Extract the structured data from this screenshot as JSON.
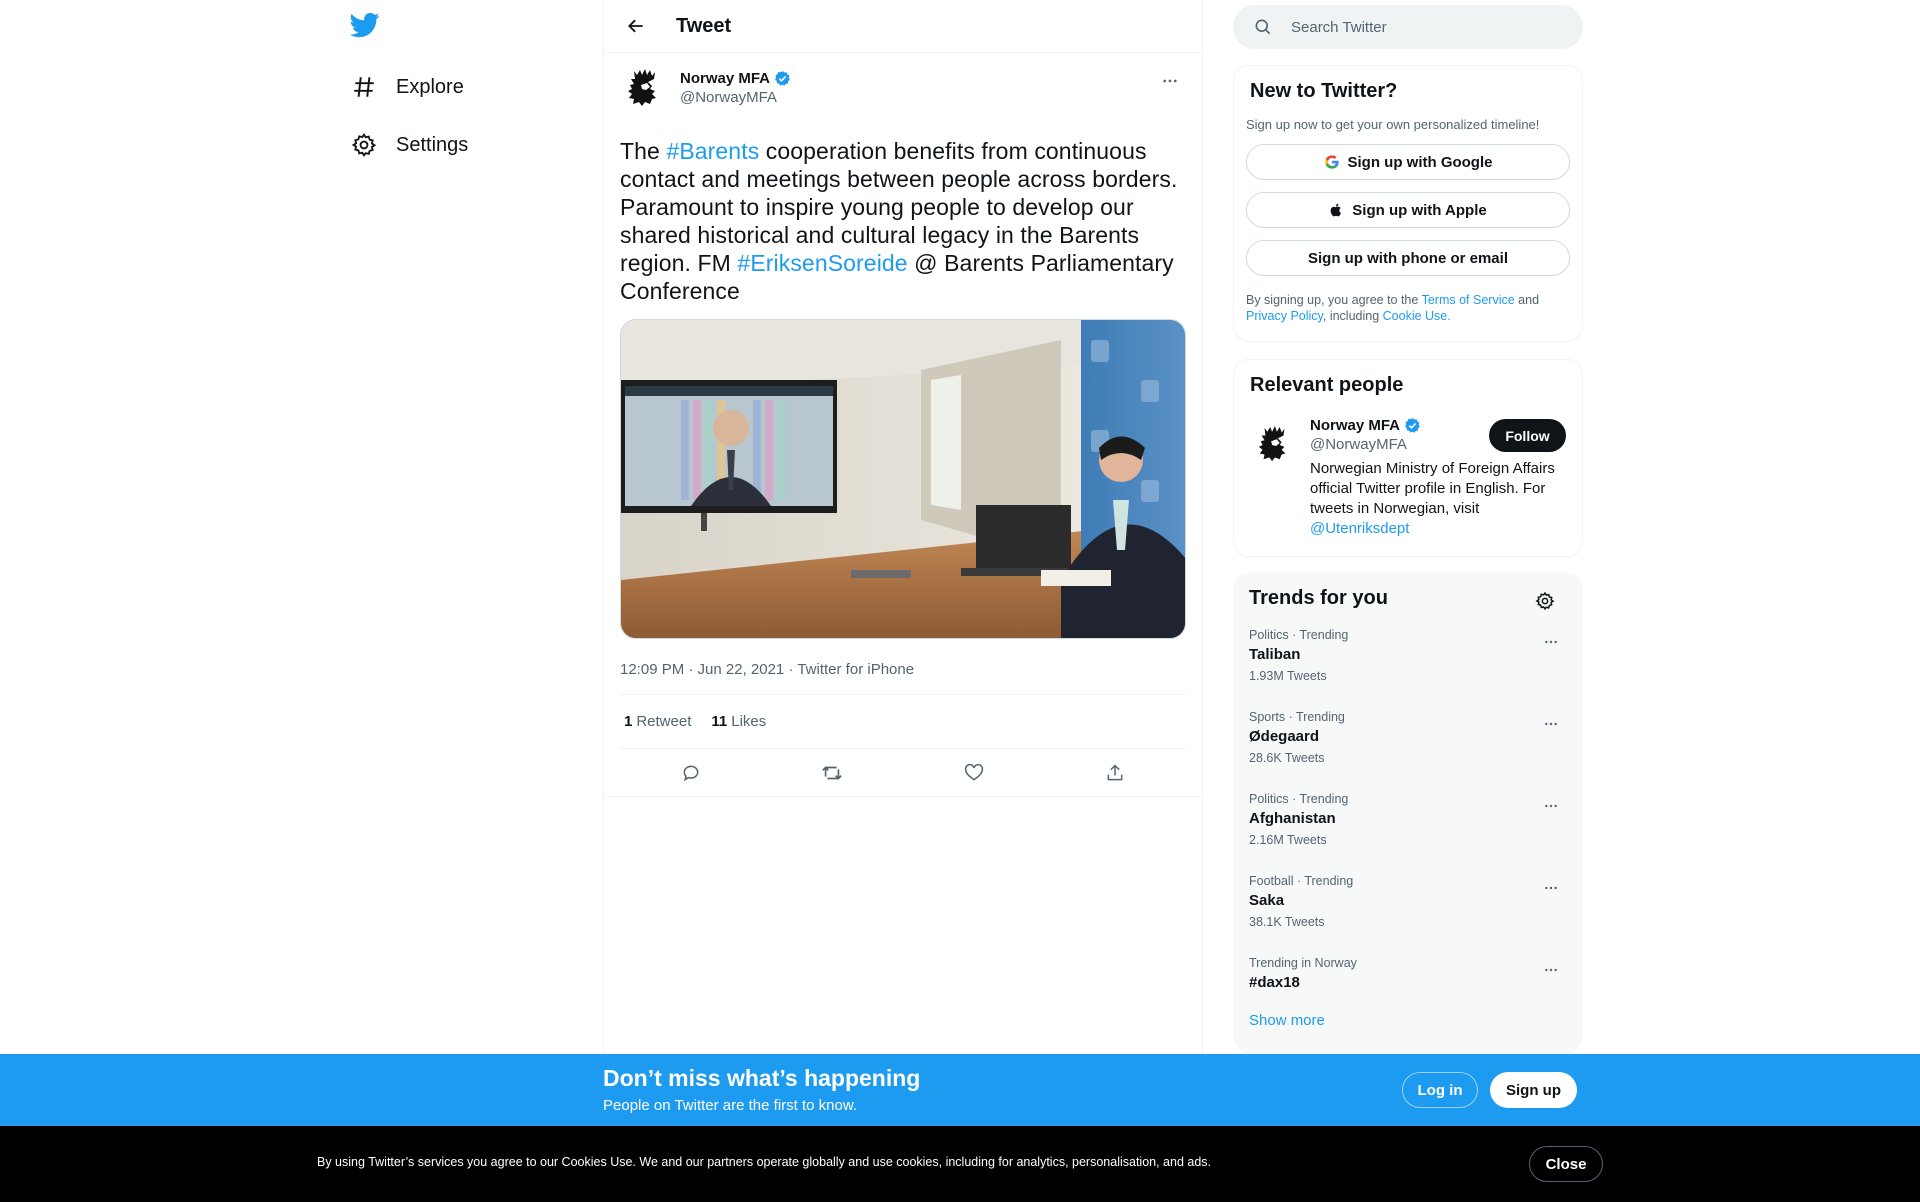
{
  "colors": {
    "accent": "#1d9bf0",
    "text": "#0f1419",
    "muted": "#536471",
    "cookie_bg": "#000000"
  },
  "nav": {
    "logo_icon": "twitter-bird-icon",
    "items": [
      {
        "label": "Explore",
        "icon": "hashtag-icon"
      },
      {
        "label": "Settings",
        "icon": "gear-icon"
      }
    ]
  },
  "header": {
    "title": "Tweet",
    "back_icon": "arrow-left-icon"
  },
  "tweet": {
    "author_name": "Norway MFA",
    "author_handle": "@NorwayMFA",
    "verified": true,
    "text_parts": {
      "p1": "The ",
      "h1": "#Barents",
      "p2": " cooperation benefits from continuous contact and meetings between people across borders. Paramount to inspire young people to develop our shared historical and cultural legacy in the Barents region. FM ",
      "h2": "#EriksenSoreide",
      "p3": " @ Barents Parliamentary Conference"
    },
    "timestamp": "12:09 PM · Jun 22, 2021",
    "separator": " · ",
    "source": "Twitter for iPhone",
    "retweets_count": "1",
    "retweets_label": "Retweet",
    "likes_count": "11",
    "likes_label": "Likes"
  },
  "search": {
    "placeholder": "Search Twitter"
  },
  "new_to_twitter": {
    "title": "New to Twitter?",
    "subtitle": "Sign up now to get your own personalized timeline!",
    "google": "Sign up with Google",
    "apple": "Sign up with Apple",
    "phone": "Sign up with phone or email",
    "legal_1": "By signing up, you agree to the ",
    "tos": "Terms of Service",
    "legal_2": " and ",
    "privacy": "Privacy Policy",
    "legal_3": ", including ",
    "cookie": "Cookie Use."
  },
  "relevant": {
    "title": "Relevant people",
    "name": "Norway MFA",
    "handle": "@NorwayMFA",
    "bio": "Norwegian Ministry of Foreign Affairs official Twitter profile in English. For tweets in Norwegian, visit ",
    "bio_link": "@Utenriksdept",
    "follow": "Follow"
  },
  "trends": {
    "title": "Trends for you",
    "items": [
      {
        "context": "Politics · Trending",
        "name": "Taliban",
        "count": "1.93M Tweets"
      },
      {
        "context": "Sports · Trending",
        "name": "Ødegaard",
        "count": "28.6K Tweets"
      },
      {
        "context": "Politics · Trending",
        "name": "Afghanistan",
        "count": "2.16M Tweets"
      },
      {
        "context": "Football · Trending",
        "name": "Saka",
        "count": "38.1K Tweets"
      },
      {
        "context": "Trending in Norway",
        "name": "#dax18",
        "count": ""
      }
    ],
    "show_more": "Show more"
  },
  "signup_bar": {
    "title": "Don’t miss what’s happening",
    "subtitle": "People on Twitter are the first to know.",
    "login": "Log in",
    "signup": "Sign up"
  },
  "cookie_bar": {
    "text": "By using Twitter’s services you agree to our Cookies Use. We and our partners operate globally and use cookies, including for analytics, personalisation, and ads.",
    "close": "Close"
  }
}
